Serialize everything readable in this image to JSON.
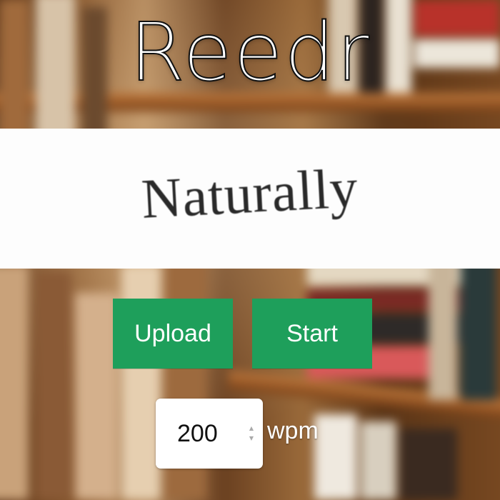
{
  "app": {
    "title": "Reedr"
  },
  "reader": {
    "current_word": "Naturally"
  },
  "controls": {
    "upload_label": "Upload",
    "start_label": "Start",
    "wpm_value": "200",
    "wpm_unit": "wpm"
  },
  "colors": {
    "button": "#1e9f5b",
    "reader_band": "#fdfdfd",
    "title": "#ffffff"
  },
  "icons": {
    "spinner_up": "chevron-up-icon",
    "spinner_down": "chevron-down-icon"
  }
}
